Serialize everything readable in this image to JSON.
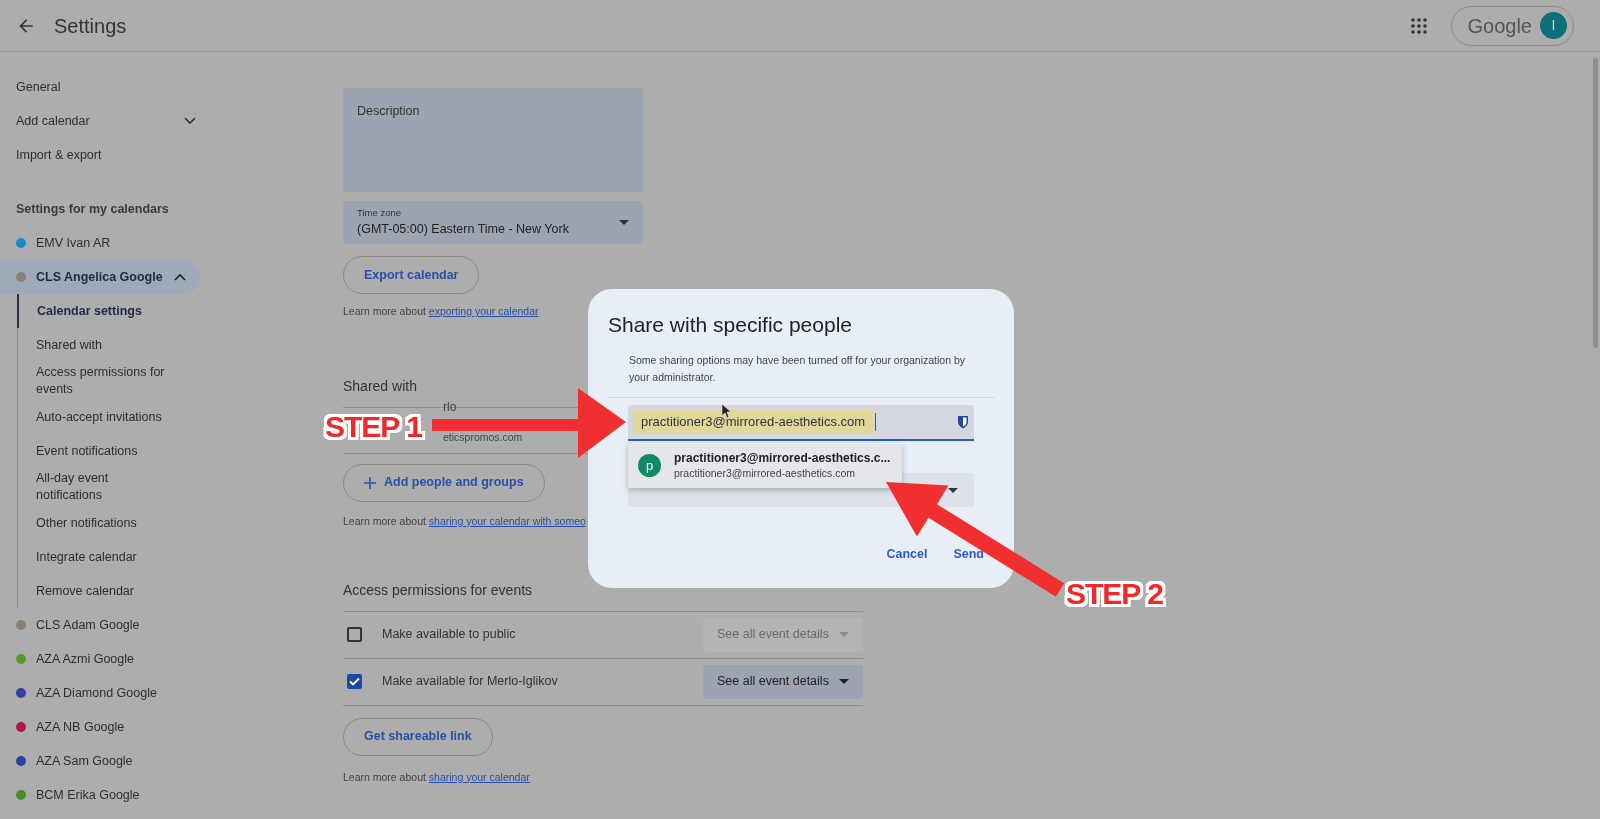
{
  "header": {
    "title": "Settings",
    "brand": "Google",
    "avatar": "I"
  },
  "sidebar": {
    "items": [
      {
        "kind": "link",
        "label": "General"
      },
      {
        "kind": "expander",
        "label": "Add calendar",
        "expanded": false
      },
      {
        "kind": "link",
        "label": "Import & export"
      },
      {
        "kind": "heading",
        "label": "Settings for my calendars"
      },
      {
        "kind": "calendar",
        "label": "EMV Ivan AR",
        "color": "#1a8ad0",
        "selected": false,
        "expanded": false
      },
      {
        "kind": "calendar",
        "label": "CLS Angelica Google",
        "color": "#8a8074",
        "selected": true,
        "expanded": true,
        "children": [
          {
            "label": "Calendar settings",
            "selected": true
          },
          {
            "label": "Shared with",
            "selected": false
          },
          {
            "label": "Access permissions for events",
            "selected": false
          },
          {
            "label": "Auto-accept invitations",
            "selected": false
          },
          {
            "label": "Event notifications",
            "selected": false
          },
          {
            "label": "All-day event notifications",
            "selected": false
          },
          {
            "label": "Other notifications",
            "selected": false
          },
          {
            "label": "Integrate calendar",
            "selected": false
          },
          {
            "label": "Remove calendar",
            "selected": false
          }
        ]
      },
      {
        "kind": "calendar",
        "label": "CLS Adam Google",
        "color": "#8a8074",
        "selected": false,
        "expanded": false
      },
      {
        "kind": "calendar",
        "label": "AZA Azmi Google",
        "color": "#5a9a2a",
        "selected": false,
        "expanded": false
      },
      {
        "kind": "calendar",
        "label": "AZA Diamond Google",
        "color": "#3340a0",
        "selected": false,
        "expanded": false
      },
      {
        "kind": "calendar",
        "label": "AZA NB Google",
        "color": "#b0184a",
        "selected": false,
        "expanded": false
      },
      {
        "kind": "calendar",
        "label": "AZA Sam Google",
        "color": "#3340a0",
        "selected": false,
        "expanded": false
      },
      {
        "kind": "calendar",
        "label": "BCM Erika Google",
        "color": "#4a8a2a",
        "selected": false,
        "expanded": false
      }
    ]
  },
  "main": {
    "description": {
      "label": "Description"
    },
    "time_zone": {
      "label": "Time zone",
      "value": "(GMT-05:00) Eastern Time - New York"
    },
    "export_button": "Export calendar",
    "export_note": {
      "text": "Learn more about",
      "link": "exporting your calendar"
    },
    "shared_with": {
      "heading": "Shared with",
      "entry_fragments": [
        "rlo",
        "eticspromos.com"
      ],
      "add_button": "Add people and groups",
      "note": {
        "text": "Learn more about",
        "link": "sharing your calendar with someo"
      }
    },
    "access": {
      "heading": "Access permissions for events",
      "rows": [
        {
          "label": "Make available to public",
          "checked": false,
          "option": "See all event details"
        },
        {
          "label": "Make available for Merlo-Iglikov",
          "checked": true,
          "option": "See all event details"
        }
      ],
      "link_button": "Get shareable link",
      "note": {
        "text": "Learn more about",
        "link": "sharing your calendar"
      }
    }
  },
  "dialog": {
    "title": "Share with specific people",
    "note": "Some sharing options may have been turned off for your organization by your administrator.",
    "input_value": "practitioner3@mirrored-aesthetics.com",
    "suggestion": {
      "avatar": "p",
      "name": "practitioner3@mirrored-aesthetics.c...",
      "email": "practitioner3@mirrored-aesthetics.com"
    },
    "buttons": [
      "Cancel",
      "Send"
    ]
  },
  "annotations": [
    {
      "label": "STEP 1"
    },
    {
      "label": "STEP 2"
    }
  ]
}
